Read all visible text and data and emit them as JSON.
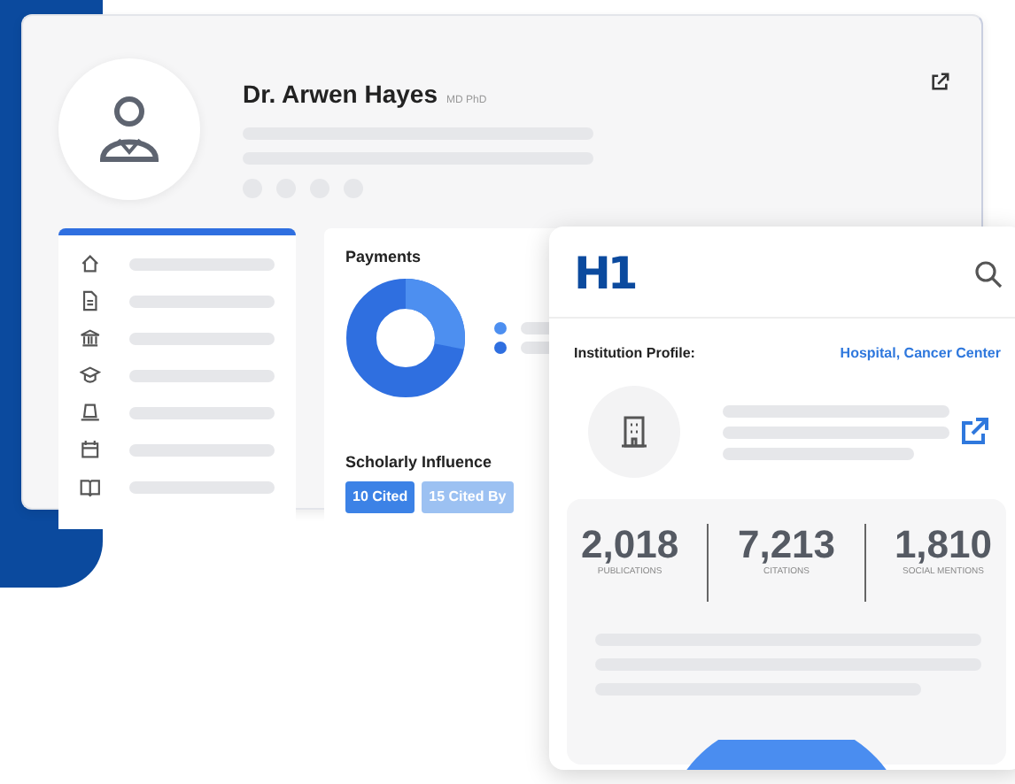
{
  "profile": {
    "name": "Dr. Arwen Hayes",
    "credentials": "MD PhD"
  },
  "payments": {
    "title": "Payments"
  },
  "scholarly_influence": {
    "title": "Scholarly Influence",
    "tabs": [
      {
        "label": "10 Cited",
        "selected": true
      },
      {
        "label": "15 Cited By",
        "selected": false
      }
    ]
  },
  "institution_card": {
    "logo": "H1",
    "profile_label": "Institution Profile:",
    "profile_value": "Hospital, Cancer Center",
    "stats": [
      {
        "value": "2,018",
        "label": "PUBLICATIONS"
      },
      {
        "value": "7,213",
        "label": "CITATIONS"
      },
      {
        "value": "1,810",
        "label": "SOCIAL MENTIONS"
      }
    ]
  }
}
